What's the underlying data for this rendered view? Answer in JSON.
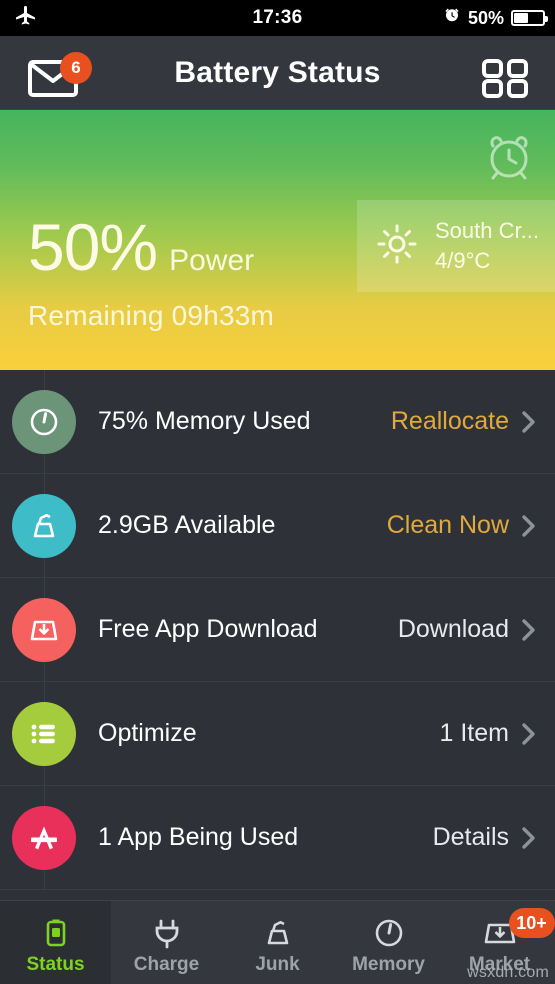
{
  "statusbar": {
    "airplane_icon": "airplane-icon",
    "time": "17:36",
    "alarm_icon": "alarm-icon",
    "battery_percent": "50%",
    "battery_level": 50
  },
  "header": {
    "title": "Battery Status",
    "mail_icon": "mail-icon",
    "mail_badge": "6",
    "grid_icon": "grid-icon"
  },
  "hero": {
    "alarm_icon": "alarm-clock-icon",
    "percent": "50%",
    "power_label": "Power",
    "remaining": "Remaining 09h33m",
    "gradient_from": "#46b45e",
    "gradient_to": "#f9cf3c",
    "weather": {
      "sun_icon": "sun-icon",
      "location": "South Cr...",
      "temperature": "4/9°C"
    }
  },
  "rows": [
    {
      "icon": "gauge-icon",
      "icon_color": "#6b9478",
      "label": "75% Memory Used",
      "action": "Reallocate",
      "action_style": "amber",
      "chevron": "chevron-right-icon"
    },
    {
      "icon": "broom-icon",
      "icon_color": "#3ebcc8",
      "label": "2.9GB Available",
      "action": "Clean Now",
      "action_style": "amber",
      "chevron": "chevron-right-icon"
    },
    {
      "icon": "download-icon",
      "icon_color": "#f4615f",
      "label": "Free App Download",
      "action": "Download",
      "action_style": "plain",
      "chevron": "chevron-right-icon"
    },
    {
      "icon": "list-icon",
      "icon_color": "#a4cc3c",
      "label": "Optimize",
      "action": "1 Item",
      "action_style": "plain",
      "chevron": "chevron-right-icon"
    },
    {
      "icon": "appstore-icon",
      "icon_color": "#e8305a",
      "label": "1 App Being Used",
      "action": "Details",
      "action_style": "plain",
      "chevron": "chevron-right-icon"
    }
  ],
  "tabbar": {
    "active_color": "#7ed321",
    "items": [
      {
        "icon": "battery-icon",
        "label": "Status",
        "active": true,
        "badge": null
      },
      {
        "icon": "plug-icon",
        "label": "Charge",
        "active": false,
        "badge": null
      },
      {
        "icon": "broom-icon",
        "label": "Junk",
        "active": false,
        "badge": null
      },
      {
        "icon": "gauge-icon",
        "label": "Memory",
        "active": false,
        "badge": null
      },
      {
        "icon": "inbox-icon",
        "label": "Market",
        "active": false,
        "badge": "10+"
      }
    ]
  },
  "watermark": "wsxdn.com"
}
